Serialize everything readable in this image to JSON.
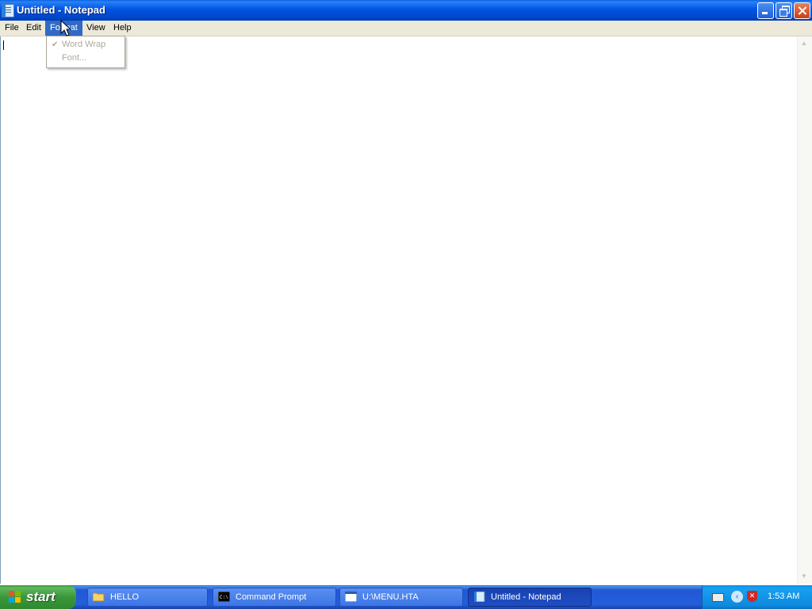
{
  "window": {
    "title": "Untitled - Notepad"
  },
  "menubar": {
    "items": [
      {
        "label": "File"
      },
      {
        "label": "Edit"
      },
      {
        "label": "Format"
      },
      {
        "label": "View"
      },
      {
        "label": "Help"
      }
    ],
    "active": "Format"
  },
  "format_menu": {
    "items": [
      {
        "label": "Word Wrap",
        "checked": true,
        "enabled": false
      },
      {
        "label": "Font...",
        "checked": false,
        "enabled": false
      }
    ]
  },
  "editor": {
    "content": ""
  },
  "taskbar": {
    "start_label": "start",
    "buttons": [
      {
        "label": "HELLO",
        "icon": "folder-icon",
        "active": false
      },
      {
        "label": "Command Prompt",
        "icon": "command-prompt-icon",
        "active": false
      },
      {
        "label": "U:\\MENU.HTA",
        "icon": "window-icon",
        "active": false
      },
      {
        "label": "Untitled - Notepad",
        "icon": "notepad-icon",
        "active": true
      }
    ],
    "tray": {
      "clock": "1:53 AM"
    }
  },
  "colors": {
    "titlebar": "#0054e3",
    "menu_highlight": "#316ac5",
    "taskbar": "#245edb",
    "start_button": "#3a963a",
    "tray": "#0f8ee8"
  }
}
